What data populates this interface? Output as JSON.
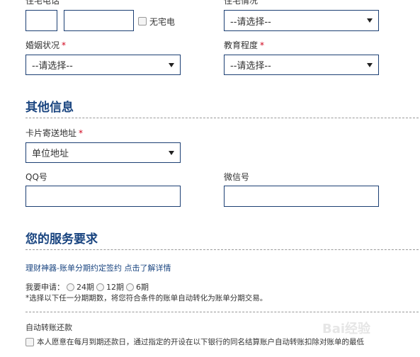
{
  "contact": {
    "home_phone_label": "住宅电话",
    "no_home_phone_label": "无宅电",
    "housing_label": "住宅情况",
    "housing_value": "--请选择--"
  },
  "marital": {
    "label": "婚姻状况",
    "required_mark": "*",
    "value": "--请选择--"
  },
  "education": {
    "label": "教育程度",
    "required_mark": "*",
    "value": "--请选择--"
  },
  "other_info": {
    "title": "其他信息",
    "card_address_label": "卡片寄送地址",
    "card_address_required": "*",
    "card_address_value": "单位地址",
    "qq_label": "QQ号",
    "qq_value": "",
    "wechat_label": "微信号",
    "wechat_value": ""
  },
  "service": {
    "title": "您的服务要求",
    "promo_link": "理财神器-账单分期约定签约 点击了解详情",
    "apply_label": "我要申请：",
    "options": [
      "24期",
      "12期",
      "6期"
    ],
    "note": "*选择以下任一分期期数，将您符合条件的账单自动转化为账单分期交易。",
    "autopay_label": "自动转账还款",
    "autopay_text": "本人愿意在每月到期还款日，通过指定的开设在以下银行的同名结算账户自动转账扣除对账单的最低"
  },
  "watermark": {
    "text": "Bai经验"
  },
  "colors": {
    "accent": "#1a4580",
    "border": "#1c3f73",
    "required": "#d0021b"
  }
}
